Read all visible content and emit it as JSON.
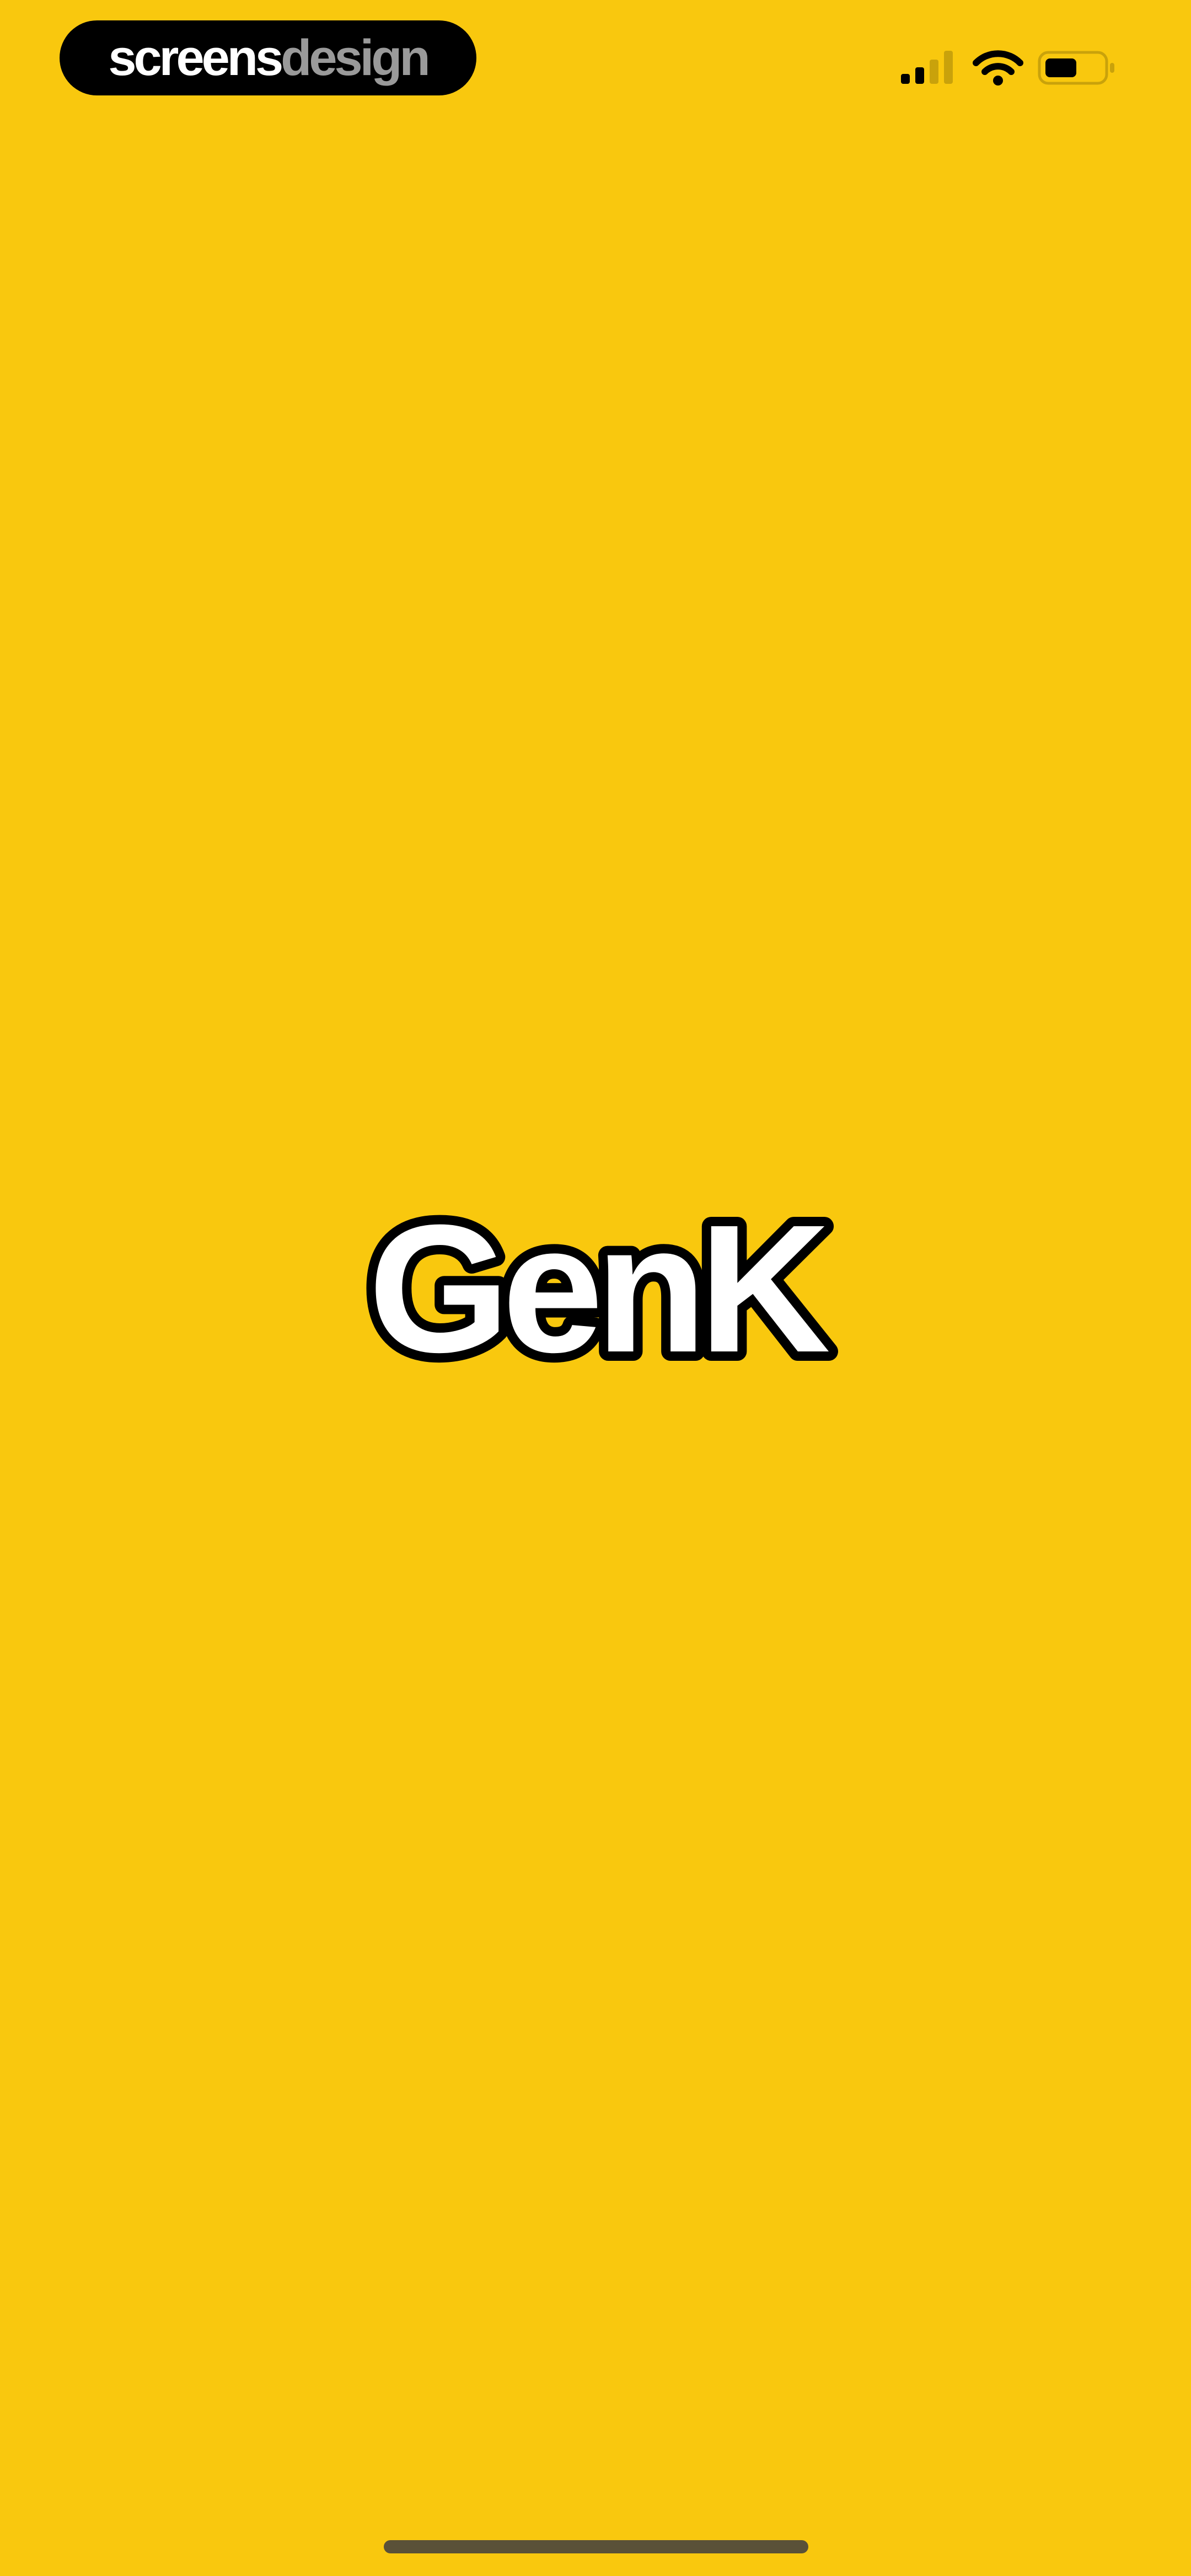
{
  "colors": {
    "background": "#F9C80E",
    "status_icons": "#000000",
    "signal_dim": "#C9A20B",
    "watermark_bg": "#000000",
    "watermark_primary": "#FFFFFF",
    "watermark_secondary": "#9A9A9A",
    "logo_fill": "#FFFFFF",
    "logo_outline": "#000000",
    "home_indicator": "#5A5138"
  },
  "status_bar": {
    "watermark_primary": "screens",
    "watermark_secondary": "design",
    "icons": [
      "cellular-signal-icon",
      "wifi-icon",
      "battery-icon"
    ]
  },
  "splash": {
    "logo_text": "GenK"
  }
}
